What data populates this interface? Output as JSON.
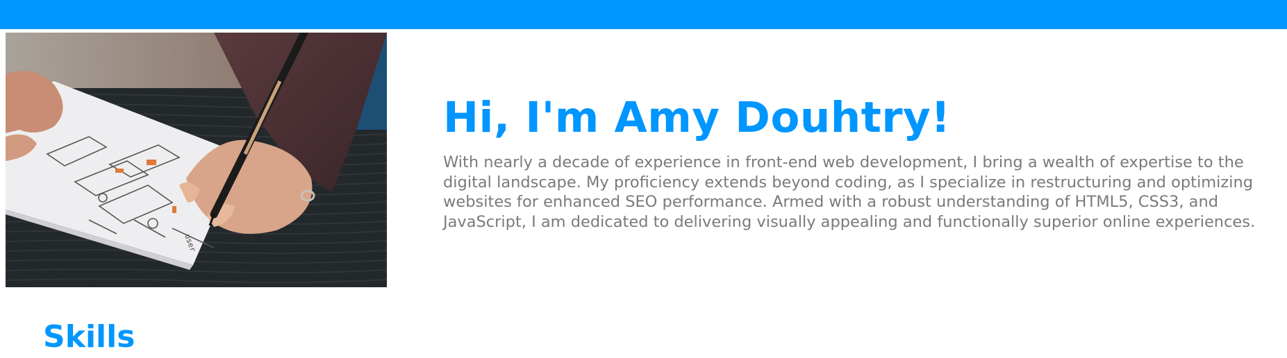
{
  "header": {
    "color": "#0096ff"
  },
  "hero": {
    "image_icon": "hand-sketching-wireframe-photo",
    "image_text": "user"
  },
  "intro": {
    "heading": "Hi, I'm Amy Douhtry!",
    "bio": "With nearly a decade of experience in front-end web development, I bring a wealth of expertise to the digital landscape. My proficiency extends beyond coding, as I specialize in restructuring and optimizing websites for enhanced SEO performance. Armed with a robust understanding of HTML5, CSS3, and JavaScript, I am dedicated to delivering visually appealing and functionally superior online experiences."
  },
  "skills": {
    "heading": "Skills"
  },
  "colors": {
    "accent": "#0096ff",
    "body_text": "#7a7a7a"
  }
}
